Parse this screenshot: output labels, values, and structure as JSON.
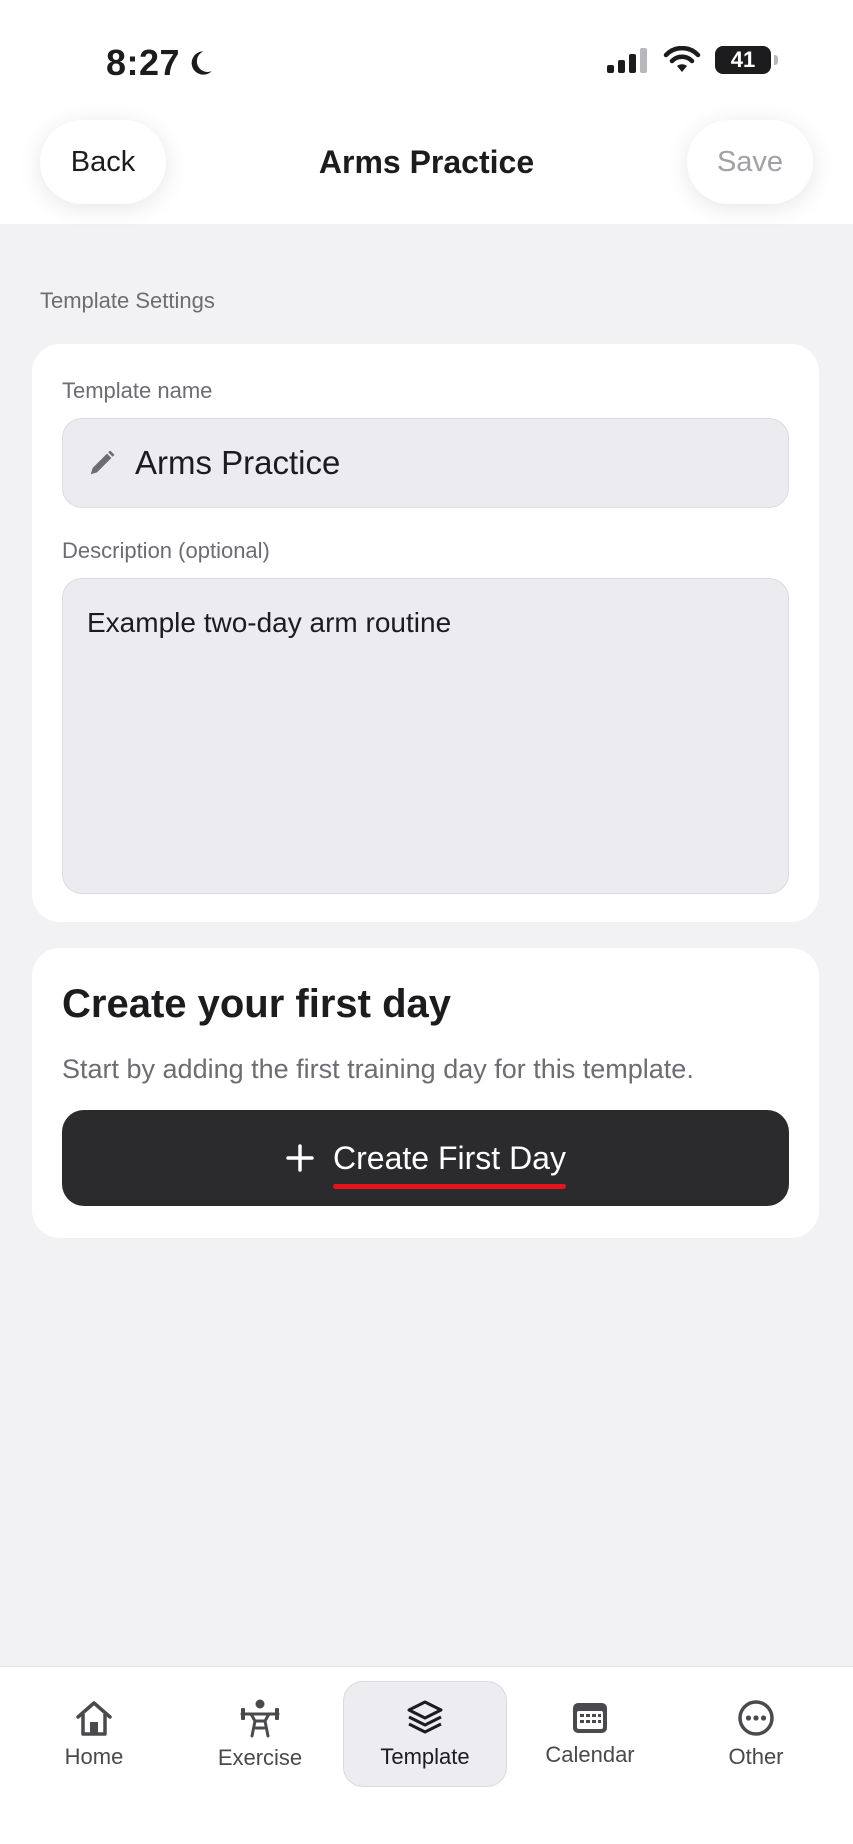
{
  "status": {
    "time": "8:27",
    "battery": "41"
  },
  "nav": {
    "back_label": "Back",
    "title": "Arms Practice",
    "save_label": "Save"
  },
  "settings": {
    "section_label": "Template Settings",
    "name_label": "Template name",
    "name_value": "Arms Practice",
    "description_label": "Description (optional)",
    "description_value": "Example two-day arm routine"
  },
  "first_day": {
    "title": "Create your first day",
    "subtitle": "Start by adding the first training day for this template.",
    "button_label": "Create First Day"
  },
  "tabs": [
    {
      "label": "Home",
      "icon": "house-icon"
    },
    {
      "label": "Exercise",
      "icon": "weightlifter-icon"
    },
    {
      "label": "Template",
      "icon": "layers-icon"
    },
    {
      "label": "Calendar",
      "icon": "calendar-icon"
    },
    {
      "label": "Other",
      "icon": "ellipsis-circle-icon"
    }
  ],
  "colors": {
    "accent_underline": "#e8141b",
    "button_dark": "#2b2b2d",
    "background": "#f2f2f5"
  }
}
